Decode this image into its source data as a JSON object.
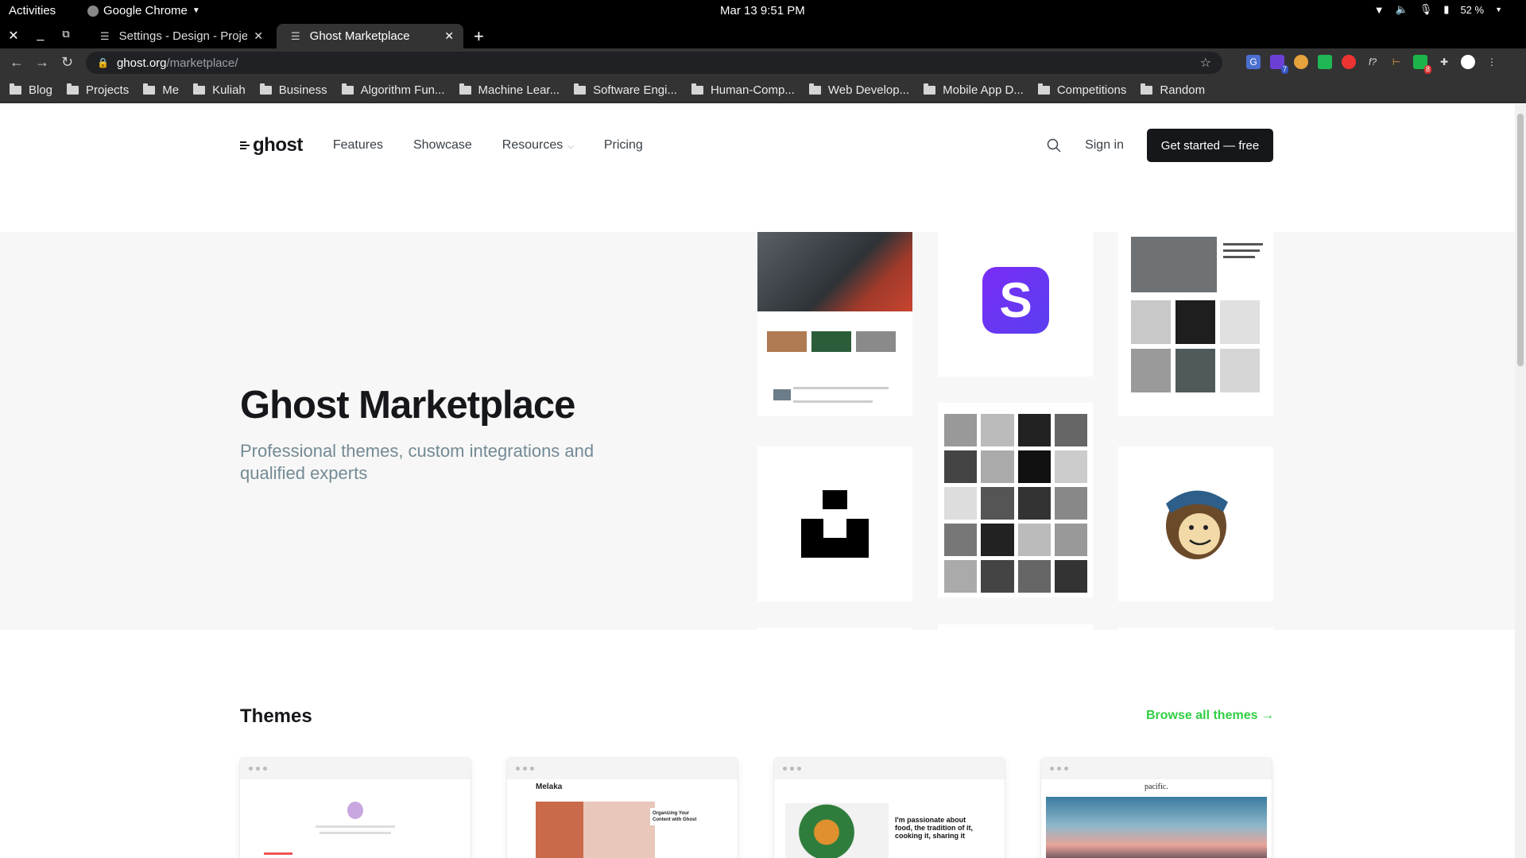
{
  "system_bar": {
    "activities": "Activities",
    "app_name": "Google Chrome",
    "clock": "Mar 13  9:51 PM",
    "battery": "52 %"
  },
  "tabs": [
    {
      "title": "Settings - Design - Projek",
      "active": false
    },
    {
      "title": "Ghost Marketplace",
      "active": true
    }
  ],
  "address_bar": {
    "host": "ghost.org",
    "path": "/marketplace/"
  },
  "extensions": {
    "badge_1": "7",
    "badge_2": "8"
  },
  "bookmarks": [
    "Blog",
    "Projects",
    "Me",
    "Kuliah",
    "Business",
    "Algorithm Fun...",
    "Machine Lear...",
    "Software Engi...",
    "Human-Comp...",
    "Web Develop...",
    "Mobile App D...",
    "Competitions",
    "Random"
  ],
  "site": {
    "logo": "ghost",
    "nav": [
      "Features",
      "Showcase",
      "Resources",
      "Pricing"
    ],
    "signin": "Sign in",
    "cta": "Get started — free"
  },
  "hero": {
    "title": "Ghost Marketplace",
    "subtitle": "Professional themes, custom integrations and qualified experts"
  },
  "themes": {
    "title": "Themes",
    "browse": "Browse all themes →",
    "cards": [
      {
        "name": ""
      },
      {
        "name": "Melaka"
      },
      {
        "name": ""
      },
      {
        "name": "pacific."
      }
    ],
    "card2_caption": "Organizing Your Content with Ghost",
    "card3_caption": "I'm passionate about food, the tradition of it, cooking it, sharing it"
  },
  "colors": {
    "accent_green": "#30cf43",
    "stripe_purple": "#7a2cf5",
    "dark": "#15171a"
  }
}
